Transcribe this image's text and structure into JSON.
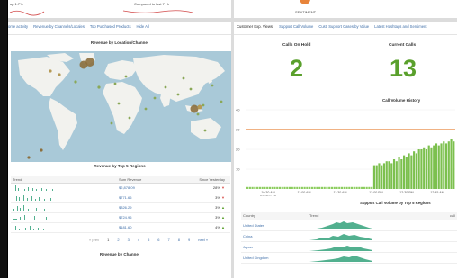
{
  "top_left": {
    "stat_a": "up 1.7%",
    "stat_b": "Compared to last 7 Hr"
  },
  "top_right": {
    "sentiment_label": "SENTIMENT"
  },
  "left": {
    "tabs": [
      "ome activity",
      "Revenue by Channels/Locales",
      "Top Purchased Products",
      "Hide All"
    ],
    "map_title": "Revenue by Location/Channel",
    "regions_title": "Revenue by Top 5 Regions",
    "table_headers": [
      "Trend",
      "Sum Revenue",
      "Since Yesterday"
    ],
    "rows": [
      {
        "revenue": "$2,878.09",
        "change": "28%",
        "dir": "down"
      },
      {
        "revenue": "$771.66",
        "change": "3%",
        "dir": "down"
      },
      {
        "revenue": "$326.29",
        "change": "3%",
        "dir": "up"
      },
      {
        "revenue": "$724.96",
        "change": "3%",
        "dir": "up"
      },
      {
        "revenue": "$181.60",
        "change": "4%",
        "dir": "up"
      }
    ],
    "pager": {
      "prev": "« prev",
      "pages": [
        "1",
        "2",
        "3",
        "4",
        "5",
        "6",
        "7",
        "8",
        "9"
      ],
      "next": "next »"
    },
    "channel_title": "Revenue by Channel"
  },
  "right": {
    "tabs": [
      "Customer Exp. Views:",
      "Support Call Volume",
      "Cust. Support Cases by Value",
      "Latest Hashtags and Sentiment"
    ],
    "calls_on_hold_label": "Calls On Hold",
    "calls_on_hold_value": "2",
    "current_calls_label": "Current Calls",
    "current_calls_value": "13",
    "volume_title": "Call Volume History",
    "y_ticks": [
      "40",
      "30",
      "20",
      "10"
    ],
    "x_ticks": [
      "10:30 AM\nSat Nov 19\n2011",
      "11:00 AM",
      "11:30 AM",
      "12:00 PM",
      "12:30 PM",
      "12:45 AM"
    ],
    "support_title": "Support Call Volume by Top 5 Regions",
    "support_headers": [
      "Country",
      "Trend"
    ],
    "support_rows": [
      "United States",
      "China",
      "Japan",
      "United Kingdom"
    ],
    "cut_header": "call"
  },
  "colors": {
    "kpi_green": "#5aa02c",
    "spark_green": "#52b08f",
    "threshold_orange": "#e8843a",
    "link_blue": "#3e6ea8",
    "down_red": "#d9534f",
    "up_green": "#5aa02c"
  },
  "chart_data": {
    "type": "bar",
    "title": "Call Volume History",
    "ylim": [
      0,
      40
    ],
    "threshold": 30,
    "values": [
      1,
      1,
      1,
      1,
      1,
      1,
      1,
      1,
      1,
      1,
      1,
      1,
      1,
      1,
      1,
      1,
      1,
      1,
      1,
      1,
      1,
      1,
      1,
      1,
      1,
      1,
      1,
      1,
      1,
      1,
      1,
      1,
      1,
      1,
      1,
      1,
      1,
      1,
      1,
      1,
      1,
      1,
      1,
      1,
      1,
      1,
      1,
      1,
      1,
      1,
      1,
      12,
      12,
      13,
      12,
      13,
      14,
      14,
      13,
      15,
      14,
      16,
      15,
      17,
      16,
      18,
      17,
      19,
      18,
      20,
      20,
      21,
      20,
      22,
      21,
      22,
      23,
      22,
      23,
      24,
      23,
      24,
      25,
      24
    ]
  }
}
